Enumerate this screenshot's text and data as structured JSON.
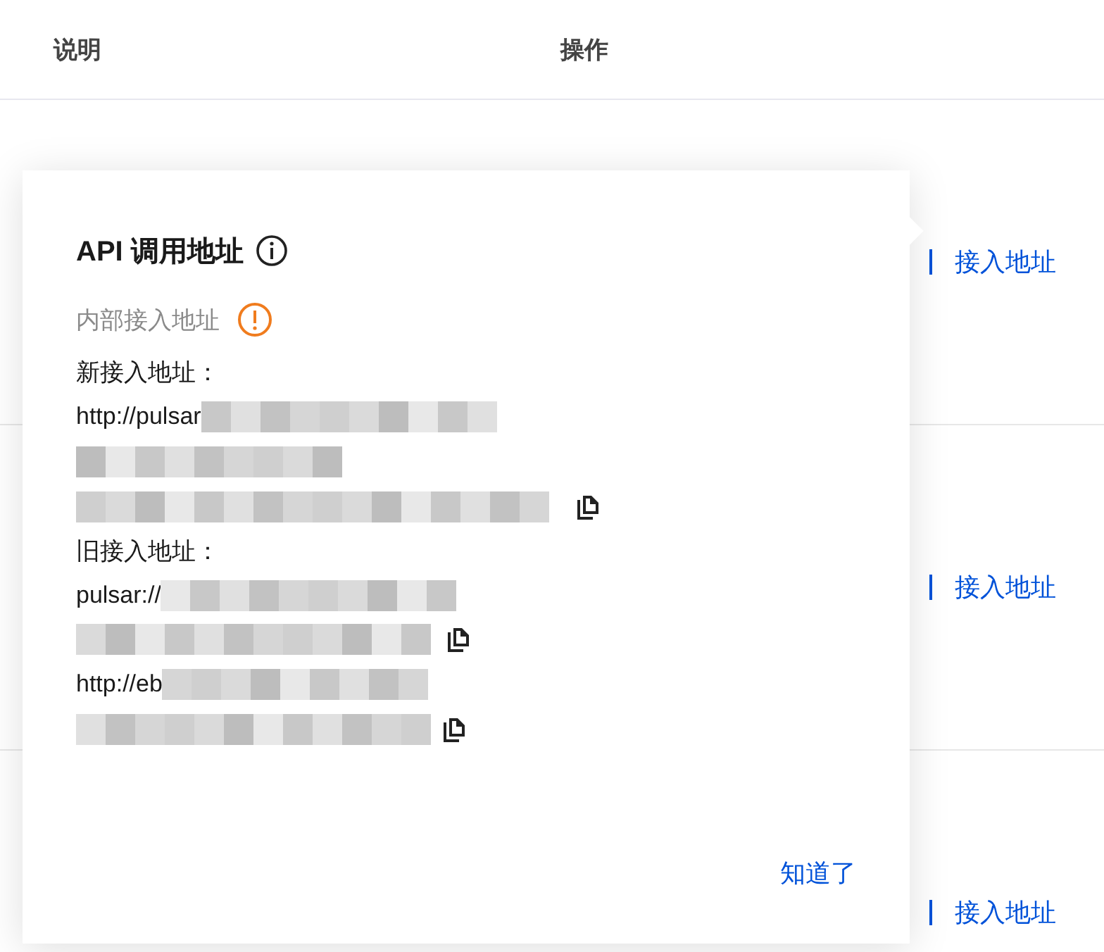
{
  "table": {
    "columns": [
      "说明",
      "操作"
    ],
    "rows": [
      {
        "action": "接入地址"
      },
      {
        "action": "接入地址"
      },
      {
        "action": "接入地址"
      }
    ]
  },
  "popover": {
    "title": "API 调用地址",
    "subtitle": "内部接入地址",
    "sections": [
      {
        "label": "新接入地址：",
        "lines": [
          {
            "prefix": "http://pulsar",
            "copy": false
          },
          {
            "copy": false
          },
          {
            "copy": true
          }
        ]
      },
      {
        "label": "旧接入地址：",
        "lines": [
          {
            "prefix": "pulsar://",
            "copy": false
          },
          {
            "copy": true
          },
          {
            "prefix": "http://eb",
            "copy": false
          },
          {
            "copy": true
          }
        ]
      }
    ],
    "confirm": "知道了"
  }
}
